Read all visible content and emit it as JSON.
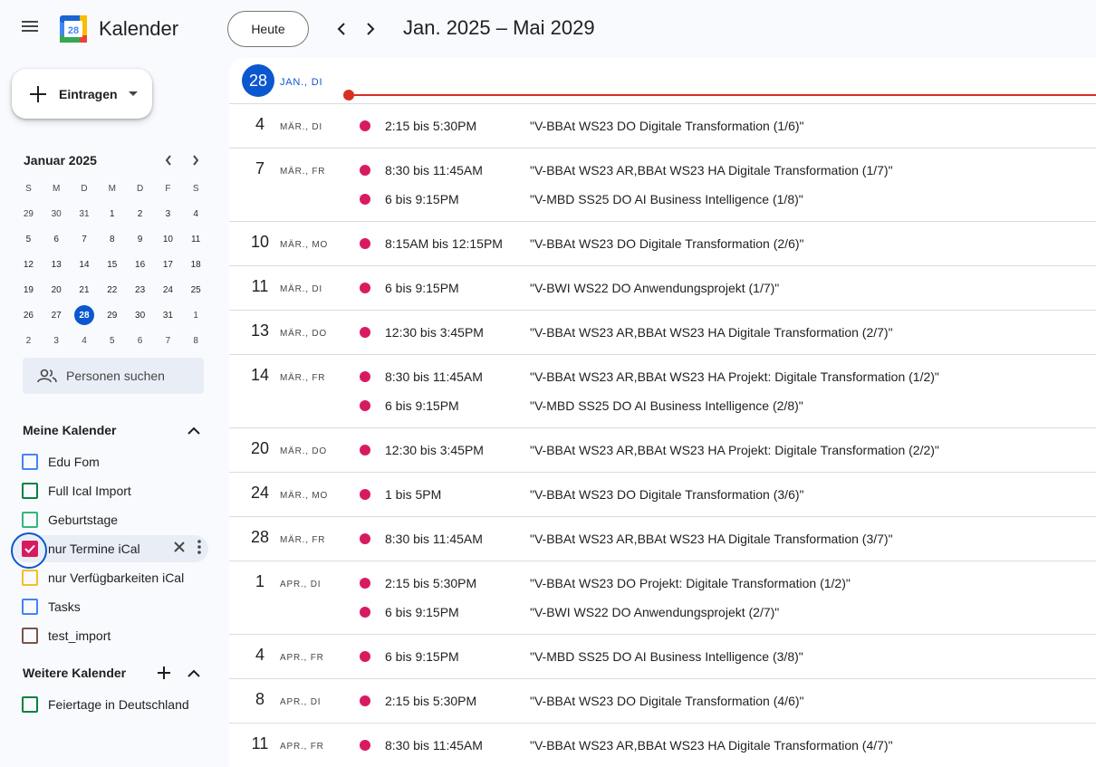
{
  "header": {
    "app_title": "Kalender",
    "logo_day": "28",
    "today_button": "Heute",
    "date_range": "Jan. 2025 – Mai 2029"
  },
  "sidebar": {
    "create_label": "Eintragen",
    "mini_calendar": {
      "title": "Januar 2025",
      "weekdays": [
        "S",
        "M",
        "D",
        "M",
        "D",
        "F",
        "S"
      ],
      "weeks": [
        [
          "29",
          "30",
          "31",
          "1",
          "2",
          "3",
          "4"
        ],
        [
          "5",
          "6",
          "7",
          "8",
          "9",
          "10",
          "11"
        ],
        [
          "12",
          "13",
          "14",
          "15",
          "16",
          "17",
          "18"
        ],
        [
          "19",
          "20",
          "21",
          "22",
          "23",
          "24",
          "25"
        ],
        [
          "26",
          "27",
          "28",
          "29",
          "30",
          "31",
          "1"
        ],
        [
          "2",
          "3",
          "4",
          "5",
          "6",
          "7",
          "8"
        ]
      ],
      "today": "28"
    },
    "people_search_placeholder": "Personen suchen",
    "my_calendars_title": "Meine Kalender",
    "my_calendars": [
      {
        "name": "Edu Fom",
        "color": "#4285f4",
        "checked": false
      },
      {
        "name": "Full Ical Import",
        "color": "#0b8043",
        "checked": false
      },
      {
        "name": "Geburtstage",
        "color": "#33b679",
        "checked": false
      },
      {
        "name": "nur Termine iCal",
        "color": "#d81b60",
        "checked": true
      },
      {
        "name": "nur Verfügbarkeiten iCal",
        "color": "#f6bf26",
        "checked": false
      },
      {
        "name": "Tasks",
        "color": "#4285f4",
        "checked": false
      },
      {
        "name": "test_import",
        "color": "#795548",
        "checked": false
      }
    ],
    "other_calendars_title": "Weitere Kalender",
    "other_calendars": [
      {
        "name": "Feiertage in Deutschland",
        "color": "#0b8043",
        "checked": false
      }
    ]
  },
  "agenda": {
    "today": {
      "day": "28",
      "label": "JAN., DI"
    },
    "days": [
      {
        "day": "4",
        "label": "MÄR., DI",
        "events": [
          {
            "time": "2:15 bis 5:30PM",
            "title": "\"V-BBAt WS23 DO Digitale Transformation (1/6)\""
          }
        ]
      },
      {
        "day": "7",
        "label": "MÄR., FR",
        "events": [
          {
            "time": "8:30 bis 11:45AM",
            "title": "\"V-BBAt WS23 AR,BBAt WS23 HA Digitale Transformation (1/7)\""
          },
          {
            "time": "6 bis 9:15PM",
            "title": "\"V-MBD SS25 DO AI Business Intelligence (1/8)\""
          }
        ]
      },
      {
        "day": "10",
        "label": "MÄR., MO",
        "events": [
          {
            "time": "8:15AM bis 12:15PM",
            "title": "\"V-BBAt WS23 DO Digitale Transformation (2/6)\""
          }
        ]
      },
      {
        "day": "11",
        "label": "MÄR., DI",
        "events": [
          {
            "time": "6 bis 9:15PM",
            "title": "\"V-BWI WS22 DO Anwendungsprojekt (1/7)\""
          }
        ]
      },
      {
        "day": "13",
        "label": "MÄR., DO",
        "events": [
          {
            "time": "12:30 bis 3:45PM",
            "title": "\"V-BBAt WS23 AR,BBAt WS23 HA Digitale Transformation (2/7)\""
          }
        ]
      },
      {
        "day": "14",
        "label": "MÄR., FR",
        "events": [
          {
            "time": "8:30 bis 11:45AM",
            "title": "\"V-BBAt WS23 AR,BBAt WS23 HA Projekt: Digitale Transformation (1/2)\""
          },
          {
            "time": "6 bis 9:15PM",
            "title": "\"V-MBD SS25 DO AI Business Intelligence (2/8)\""
          }
        ]
      },
      {
        "day": "20",
        "label": "MÄR., DO",
        "events": [
          {
            "time": "12:30 bis 3:45PM",
            "title": "\"V-BBAt WS23 AR,BBAt WS23 HA Projekt: Digitale Transformation (2/2)\""
          }
        ]
      },
      {
        "day": "24",
        "label": "MÄR., MO",
        "events": [
          {
            "time": "1 bis 5PM",
            "title": "\"V-BBAt WS23 DO Digitale Transformation (3/6)\""
          }
        ]
      },
      {
        "day": "28",
        "label": "MÄR., FR",
        "events": [
          {
            "time": "8:30 bis 11:45AM",
            "title": "\"V-BBAt WS23 AR,BBAt WS23 HA Digitale Transformation (3/7)\""
          }
        ]
      },
      {
        "day": "1",
        "label": "APR., DI",
        "events": [
          {
            "time": "2:15 bis 5:30PM",
            "title": "\"V-BBAt WS23 DO Projekt: Digitale Transformation (1/2)\""
          },
          {
            "time": "6 bis 9:15PM",
            "title": "\"V-BWI WS22 DO Anwendungsprojekt (2/7)\""
          }
        ]
      },
      {
        "day": "4",
        "label": "APR., FR",
        "events": [
          {
            "time": "6 bis 9:15PM",
            "title": "\"V-MBD SS25 DO AI Business Intelligence (3/8)\""
          }
        ]
      },
      {
        "day": "8",
        "label": "APR., DI",
        "events": [
          {
            "time": "2:15 bis 5:30PM",
            "title": "\"V-BBAt WS23 DO Digitale Transformation (4/6)\""
          }
        ]
      },
      {
        "day": "11",
        "label": "APR., FR",
        "events": [
          {
            "time": "8:30 bis 11:45AM",
            "title": "\"V-BBAt WS23 AR,BBAt WS23 HA Digitale Transformation (4/7)\""
          }
        ]
      }
    ]
  },
  "colors": {
    "accent": "#0b57d0",
    "event_dot": "#d81b60",
    "now_line": "#d93025"
  }
}
